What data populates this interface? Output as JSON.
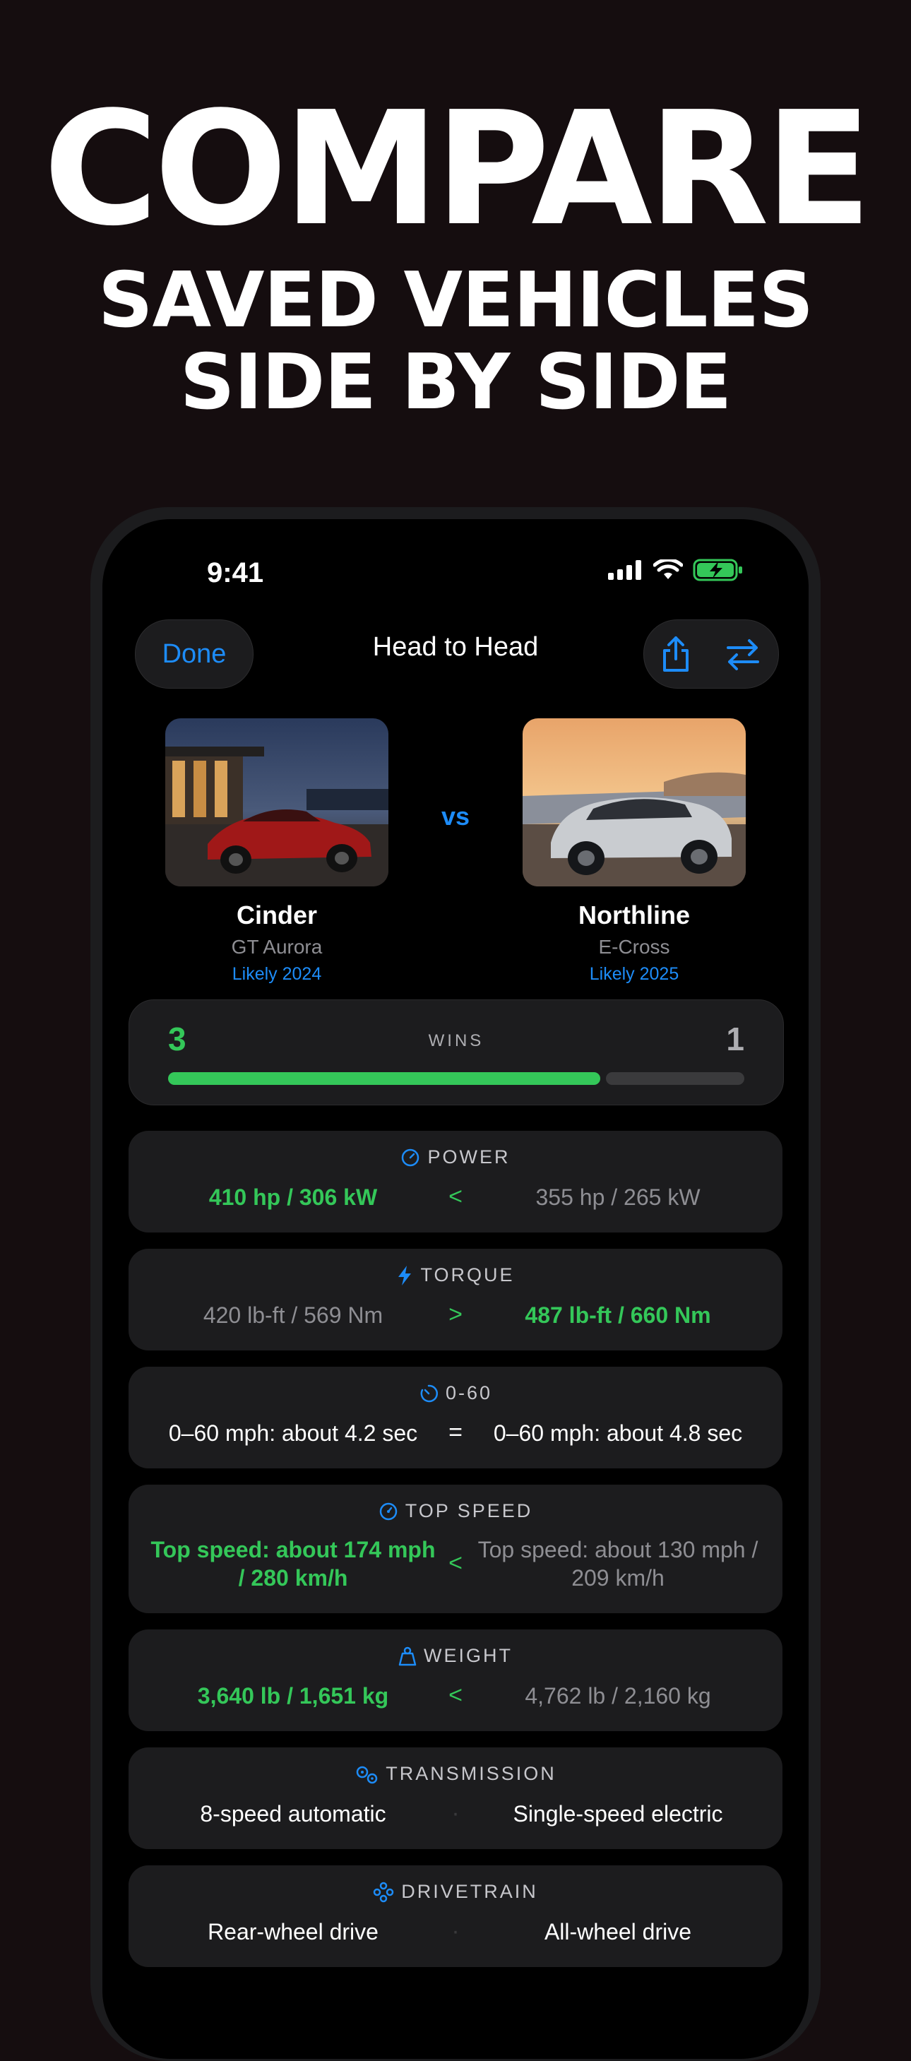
{
  "hero": {
    "line1": "COMPARE",
    "line2": "SAVED VEHICLES",
    "line3": "SIDE BY SIDE"
  },
  "status_bar": {
    "time": "9:41"
  },
  "nav": {
    "done_label": "Done",
    "title": "Head to Head",
    "share_icon": "share-icon",
    "swap_icon": "swap-arrows-icon"
  },
  "vs_label": "vs",
  "cars": {
    "left": {
      "name": "Cinder",
      "model": "GT Aurora",
      "year": "Likely 2024"
    },
    "right": {
      "name": "Northline",
      "model": "E-Cross",
      "year": "Likely 2025"
    }
  },
  "wins": {
    "label": "WINS",
    "left_count": "3",
    "right_count": "1",
    "left_share": 0.75
  },
  "specs": [
    {
      "key": "power",
      "label": "POWER",
      "icon": "gauge-icon",
      "left": "410 hp / 306 kW",
      "right": "355 hp / 265 kW",
      "compare": "<",
      "winner": "left"
    },
    {
      "key": "torque",
      "label": "TORQUE",
      "icon": "bolt-icon",
      "left": "420 lb-ft / 569 Nm",
      "right": "487 lb-ft / 660 Nm",
      "compare": ">",
      "winner": "right"
    },
    {
      "key": "zero_sixty",
      "label": "0-60",
      "icon": "timer-icon",
      "left": "0–60 mph: about 4.2 sec",
      "right": "0–60 mph: about 4.8 sec",
      "compare": "=",
      "winner": "none"
    },
    {
      "key": "top_speed",
      "label": "TOP SPEED",
      "icon": "speedometer-icon",
      "left": "Top speed: about 174 mph / 280 km/h",
      "right": "Top speed: about 130 mph / 209 km/h",
      "compare": "<",
      "winner": "left"
    },
    {
      "key": "weight",
      "label": "WEIGHT",
      "icon": "weight-icon",
      "left": "3,640 lb / 1,651 kg",
      "right": "4,762 lb / 2,160 kg",
      "compare": "<",
      "winner": "left"
    },
    {
      "key": "transmission",
      "label": "TRANSMISSION",
      "icon": "gears-icon",
      "left": "8-speed automatic",
      "right": "Single-speed electric",
      "compare": "·",
      "winner": "none"
    },
    {
      "key": "drivetrain",
      "label": "DRIVETRAIN",
      "icon": "drivetrain-icon",
      "left": "Rear-wheel drive",
      "right": "All-wheel drive",
      "compare": "·",
      "winner": "none"
    }
  ],
  "colors": {
    "accent_blue": "#1d8cf8",
    "win_green": "#34c759",
    "card_bg": "#1c1c1e",
    "page_bg": "#150d0f"
  }
}
